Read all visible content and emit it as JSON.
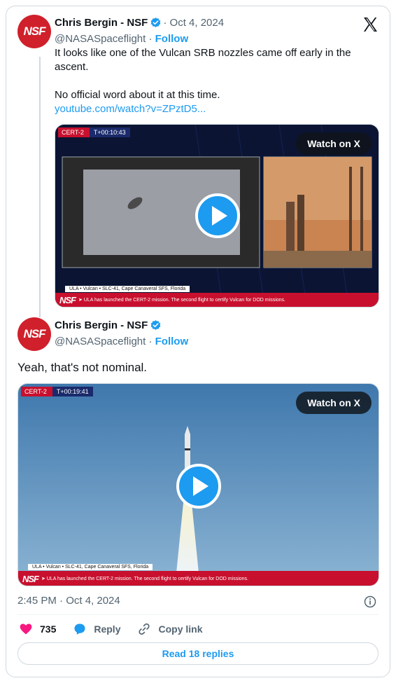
{
  "tweet1": {
    "avatar_text": "NSF",
    "name": "Chris Bergin - NSF",
    "date": "· Oct 4, 2024",
    "handle": "@NASASpaceflight",
    "sep": " · ",
    "follow": "Follow",
    "text_line1": "It looks like one of the Vulcan SRB nozzles came off early in the ascent.",
    "text_line2": "No official word about it at this time.",
    "link": "youtube.com/watch?v=ZPztD5...",
    "media": {
      "watch_label": "Watch on X",
      "mission": "CERT-2",
      "clock": "T+00:10:43",
      "ticker_top": "ULA  •  Vulcan  •  SLC-41, Cape Canaveral SFS, Florida",
      "ticker_nsf": "NSF",
      "ticker_text": "➤ ULA has launched the CERT-2 mission. The second flight to certify Vulcan for DOD missions."
    }
  },
  "tweet2": {
    "avatar_text": "NSF",
    "name": "Chris Bergin - NSF",
    "handle": "@NASASpaceflight",
    "sep": " · ",
    "follow": "Follow",
    "text": "Yeah, that's not nominal.",
    "media": {
      "watch_label": "Watch on X",
      "mission": "CERT-2",
      "clock": "T+00:19:41",
      "ticker_top": "ULA  •  Vulcan  •  SLC-41, Cape Canaveral SFS, Florida",
      "ticker_nsf": "NSF",
      "ticker_text": "➤ ULA has launched the CERT-2 mission. The second flight to certify Vulcan for DOD missions."
    },
    "timestamp": "2:45 PM · Oct 4, 2024"
  },
  "actions": {
    "likes": "735",
    "reply": "Reply",
    "copy": "Copy link"
  },
  "read_replies": "Read 18 replies",
  "colors": {
    "accent": "#1d9bf0",
    "like": "#f91880",
    "brand_red": "#d0202b"
  },
  "icons": [
    "x-logo-icon",
    "verified-badge-icon",
    "play-icon",
    "info-icon",
    "heart-icon",
    "reply-bubble-icon",
    "link-icon"
  ]
}
